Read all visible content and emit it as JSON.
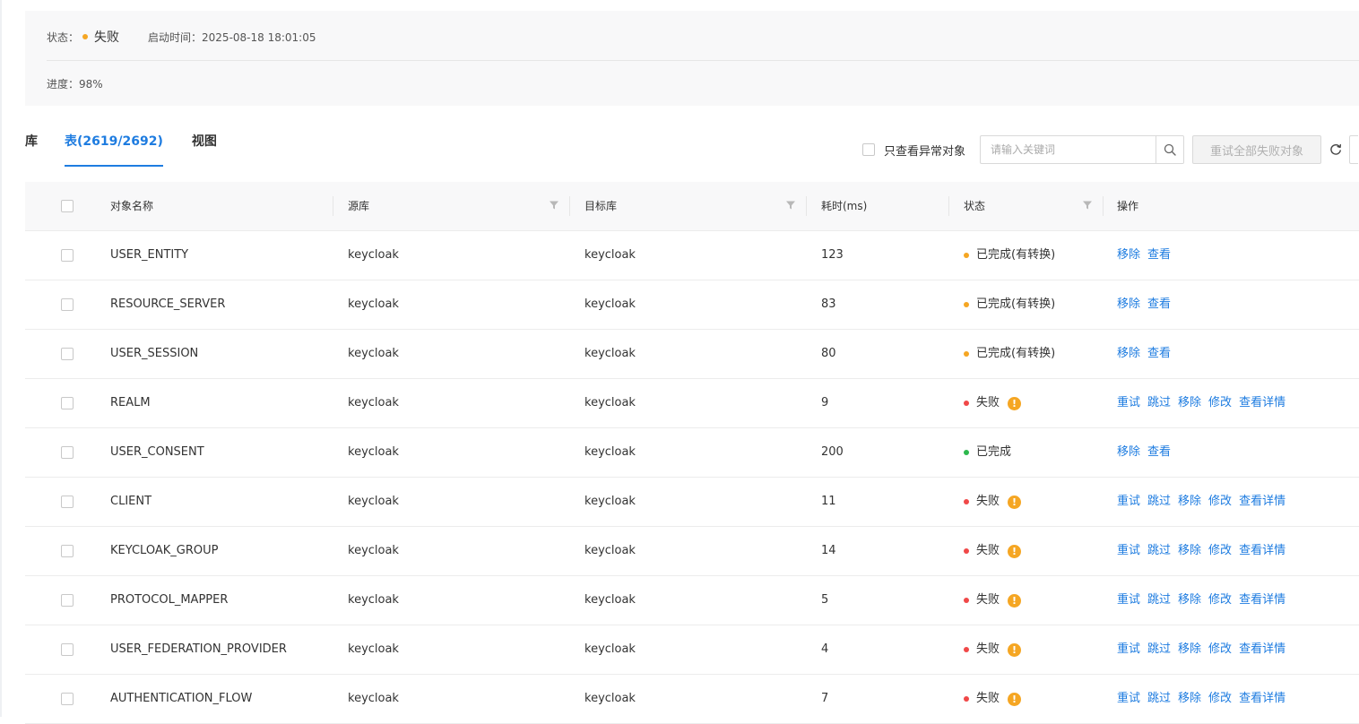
{
  "colors": {
    "accent": "#1e7ce0",
    "orange": "#f5a623",
    "red": "#f04848",
    "green": "#2db84d"
  },
  "summary": {
    "status_label": "状态：",
    "status_value": "失败",
    "start_label": "启动时间：",
    "start_value": "2025-08-18 18:01:05",
    "progress_label": "进度：",
    "progress_value": "98%"
  },
  "tabs": [
    {
      "label": "库"
    },
    {
      "label": "表(2619/2692)"
    },
    {
      "label": "视图"
    }
  ],
  "toolbar": {
    "only_abnormal_label": "只查看异常对象",
    "search_placeholder": "请输入关键词",
    "retry_all_label": "重试全部失败对象"
  },
  "table": {
    "columns": {
      "name": "对象名称",
      "source": "源库",
      "target": "目标库",
      "elapsed": "耗时(ms)",
      "status": "状态",
      "ops": "操作"
    },
    "rows": [
      {
        "name": "USER_ENTITY",
        "source": "keycloak",
        "target": "keycloak",
        "elapsed": "123",
        "status": "已完成(有转换)",
        "status_color": "#f5a623",
        "warn": false,
        "ops": [
          "移除",
          "查看"
        ]
      },
      {
        "name": "RESOURCE_SERVER",
        "source": "keycloak",
        "target": "keycloak",
        "elapsed": "83",
        "status": "已完成(有转换)",
        "status_color": "#f5a623",
        "warn": false,
        "ops": [
          "移除",
          "查看"
        ]
      },
      {
        "name": "USER_SESSION",
        "source": "keycloak",
        "target": "keycloak",
        "elapsed": "80",
        "status": "已完成(有转换)",
        "status_color": "#f5a623",
        "warn": false,
        "ops": [
          "移除",
          "查看"
        ]
      },
      {
        "name": "REALM",
        "source": "keycloak",
        "target": "keycloak",
        "elapsed": "9",
        "status": "失败",
        "status_color": "#f04848",
        "warn": true,
        "ops": [
          "重试",
          "跳过",
          "移除",
          "修改",
          "查看详情"
        ]
      },
      {
        "name": "USER_CONSENT",
        "source": "keycloak",
        "target": "keycloak",
        "elapsed": "200",
        "status": "已完成",
        "status_color": "#2db84d",
        "warn": false,
        "ops": [
          "移除",
          "查看"
        ]
      },
      {
        "name": "CLIENT",
        "source": "keycloak",
        "target": "keycloak",
        "elapsed": "11",
        "status": "失败",
        "status_color": "#f04848",
        "warn": true,
        "ops": [
          "重试",
          "跳过",
          "移除",
          "修改",
          "查看详情"
        ]
      },
      {
        "name": "KEYCLOAK_GROUP",
        "source": "keycloak",
        "target": "keycloak",
        "elapsed": "14",
        "status": "失败",
        "status_color": "#f04848",
        "warn": true,
        "ops": [
          "重试",
          "跳过",
          "移除",
          "修改",
          "查看详情"
        ]
      },
      {
        "name": "PROTOCOL_MAPPER",
        "source": "keycloak",
        "target": "keycloak",
        "elapsed": "5",
        "status": "失败",
        "status_color": "#f04848",
        "warn": true,
        "ops": [
          "重试",
          "跳过",
          "移除",
          "修改",
          "查看详情"
        ]
      },
      {
        "name": "USER_FEDERATION_PROVIDER",
        "source": "keycloak",
        "target": "keycloak",
        "elapsed": "4",
        "status": "失败",
        "status_color": "#f04848",
        "warn": true,
        "ops": [
          "重试",
          "跳过",
          "移除",
          "修改",
          "查看详情"
        ]
      },
      {
        "name": "AUTHENTICATION_FLOW",
        "source": "keycloak",
        "target": "keycloak",
        "elapsed": "7",
        "status": "失败",
        "status_color": "#f04848",
        "warn": true,
        "ops": [
          "重试",
          "跳过",
          "移除",
          "修改",
          "查看详情"
        ]
      }
    ]
  }
}
